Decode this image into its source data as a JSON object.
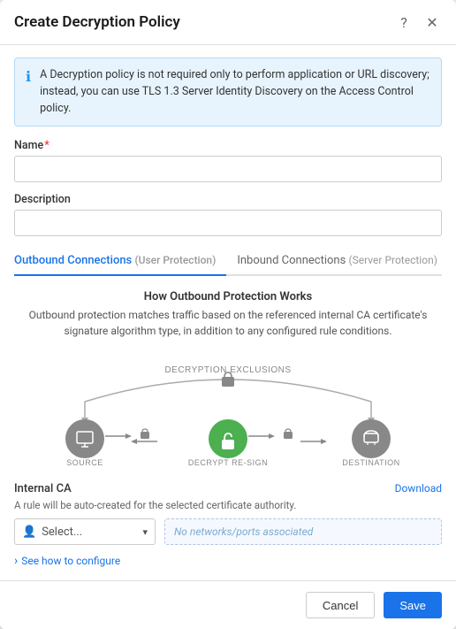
{
  "dialog": {
    "title": "Create Decryption Policy",
    "help_icon": "?",
    "close_icon": "✕"
  },
  "info_banner": {
    "text": "A Decryption policy is not required only to perform application or URL discovery; instead, you can use TLS 1.3 Server Identity Discovery on the Access Control policy."
  },
  "form": {
    "name_label": "Name",
    "name_required": true,
    "description_label": "Description"
  },
  "tabs": [
    {
      "label": "Outbound Connections",
      "secondary": "(User Protection)",
      "active": true
    },
    {
      "label": "Inbound Connections",
      "secondary": "(Server Protection)",
      "active": false
    }
  ],
  "protection": {
    "title": "How Outbound Protection Works",
    "description": "Outbound protection matches traffic based on the referenced internal CA certificate's signature algorithm type, in addition to any configured rule conditions."
  },
  "diagram": {
    "exclusions_label": "DECRYPTION EXCLUSIONS",
    "source_label": "SOURCE",
    "decrypt_label": "DECRYPT RE-SIGN",
    "destination_label": "DESTINATION"
  },
  "internal_ca": {
    "label": "Internal CA",
    "download_label": "Download",
    "hint": "A rule will be auto-created for the selected certificate authority.",
    "select_placeholder": "Select...",
    "networks_placeholder": "No networks/ports associated"
  },
  "configure_link": "See how to configure",
  "footer": {
    "cancel_label": "Cancel",
    "save_label": "Save"
  }
}
